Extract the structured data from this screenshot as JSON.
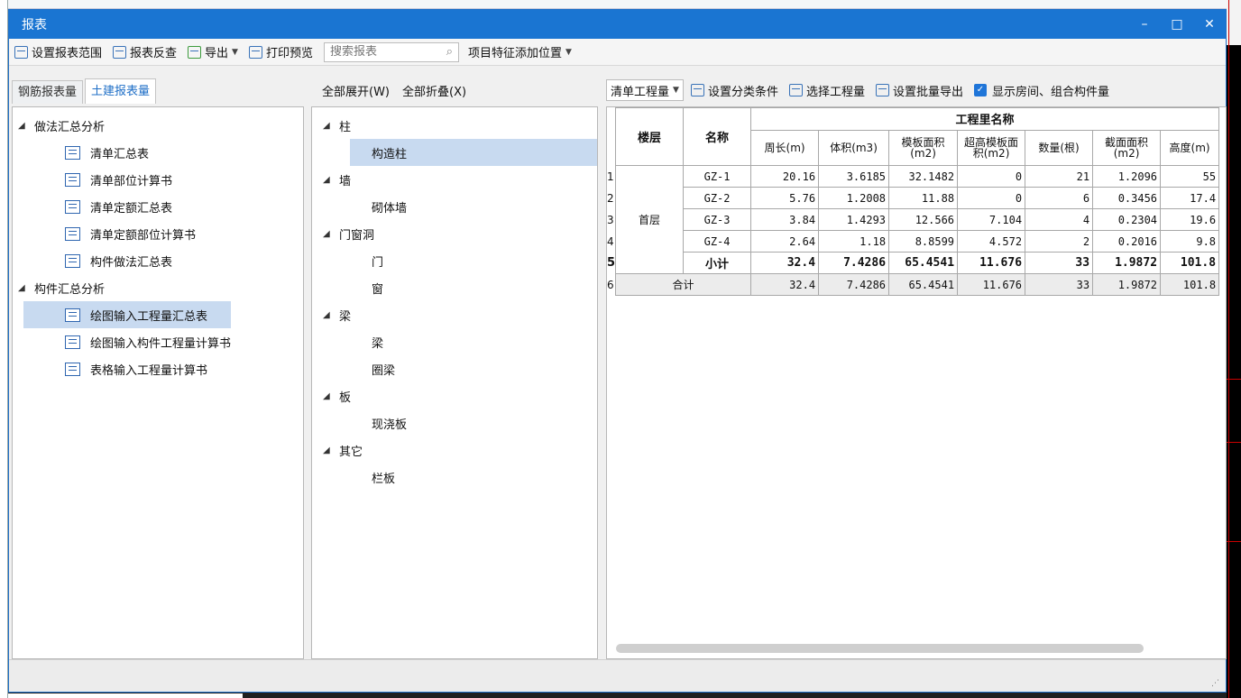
{
  "window": {
    "title": "报表",
    "min": "–",
    "max": "□",
    "close": "✕"
  },
  "toolbar": {
    "set_range": "设置报表范围",
    "reverse_check": "报表反查",
    "export": "导出",
    "print_preview": "打印预览",
    "search_placeholder": "搜索报表",
    "item_feature_pos": "项目特征添加位置"
  },
  "tabs": [
    "钢筋报表量",
    "土建报表量"
  ],
  "left_tree": {
    "group1": "做法汇总分析",
    "group1_items": [
      "清单汇总表",
      "清单部位计算书",
      "清单定额汇总表",
      "清单定额部位计算书",
      "构件做法汇总表"
    ],
    "group2": "构件汇总分析",
    "group2_items": [
      "绘图输入工程量汇总表",
      "绘图输入构件工程量计算书",
      "表格输入工程量计算书"
    ]
  },
  "middle": {
    "expand_all": "全部展开(W)",
    "collapse_all": "全部折叠(X)",
    "tree": [
      {
        "label": "柱",
        "children": [
          "构造柱"
        ]
      },
      {
        "label": "墙",
        "children": [
          "砌体墙"
        ]
      },
      {
        "label": "门窗洞",
        "children": [
          "门",
          "窗"
        ]
      },
      {
        "label": "梁",
        "children": [
          "梁",
          "圈梁"
        ]
      },
      {
        "label": "板",
        "children": [
          "现浇板"
        ]
      },
      {
        "label": "其它",
        "children": [
          "栏板"
        ]
      }
    ]
  },
  "right_toolbar": {
    "combo": "清单工程量",
    "set_category": "设置分类条件",
    "select_qty": "选择工程量",
    "batch_export": "设置批量导出",
    "show_rooms": "显示房间、组合构件量"
  },
  "table": {
    "col_floor": "楼层",
    "col_name": "名称",
    "group_header": "工程里名称",
    "columns": [
      "周长(m)",
      "体积(m3)",
      "模板面积(m2)",
      "超高模板面积(m2)",
      "数量(根)",
      "截面面积(m2)",
      "高度(m)"
    ],
    "floor": "首层",
    "rows": [
      {
        "n": "1",
        "name": "GZ-1",
        "v": [
          "20.16",
          "3.6185",
          "32.1482",
          "0",
          "21",
          "1.2096",
          "55"
        ]
      },
      {
        "n": "2",
        "name": "GZ-2",
        "v": [
          "5.76",
          "1.2008",
          "11.88",
          "0",
          "6",
          "0.3456",
          "17.4"
        ]
      },
      {
        "n": "3",
        "name": "GZ-3",
        "v": [
          "3.84",
          "1.4293",
          "12.566",
          "7.104",
          "4",
          "0.2304",
          "19.6"
        ]
      },
      {
        "n": "4",
        "name": "GZ-4",
        "v": [
          "2.64",
          "1.18",
          "8.8599",
          "4.572",
          "2",
          "0.2016",
          "9.8"
        ]
      }
    ],
    "subtotal": {
      "n": "5",
      "label": "小计",
      "v": [
        "32.4",
        "7.4286",
        "65.4541",
        "11.676",
        "33",
        "1.9872",
        "101.8"
      ]
    },
    "total": {
      "n": "6",
      "label": "合计",
      "v": [
        "32.4",
        "7.4286",
        "65.4541",
        "11.676",
        "33",
        "1.9872",
        "101.8"
      ]
    }
  }
}
